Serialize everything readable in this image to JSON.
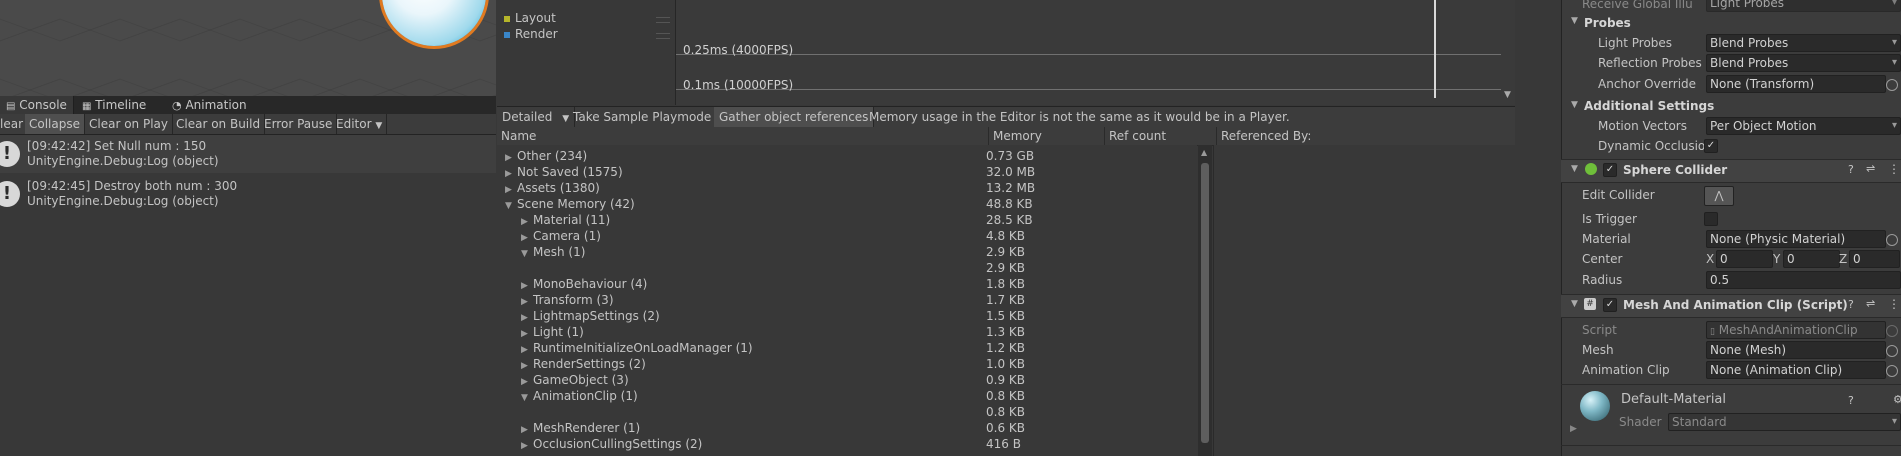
{
  "scene": {},
  "console": {
    "tabs": [
      {
        "label": "Console",
        "icon": "console-icon"
      },
      {
        "label": "Timeline",
        "icon": "timeline-icon"
      },
      {
        "label": "Animation",
        "icon": "animation-icon"
      }
    ],
    "toolbar": {
      "clear": "lear",
      "collapse": "Collapse",
      "clear_on_play": "Clear on Play",
      "clear_on_build": "Clear on Build",
      "error_pause": "Error Pause",
      "editor": "Editor"
    },
    "logs": [
      {
        "line1": "[09:42:42] Set Null num :  150",
        "line2": "UnityEngine.Debug:Log (object)"
      },
      {
        "line1": "[09:42:45] Destroy both num :  300",
        "line2": "UnityEngine.Debug:Log (object)"
      }
    ]
  },
  "profiler": {
    "legend": [
      {
        "label": "Layout",
        "color": "#b5b52a"
      },
      {
        "label": "Render",
        "color": "#3a86c8"
      }
    ],
    "gridlines": [
      "0.25ms (4000FPS)",
      "0.1ms (10000FPS)"
    ],
    "toolbar": {
      "view_mode": "Detailed",
      "take_sample": "Take Sample Playmode",
      "gather_refs": "Gather object references",
      "notice": "Memory usage in the Editor is not the same as it would be in a Player."
    },
    "columns": {
      "name": "Name",
      "memory": "Memory",
      "ref_count": "Ref count",
      "referenced_by": "Referenced By:"
    },
    "rows": [
      {
        "name": "Other (234)",
        "memory": "0.73 GB",
        "expanded": false,
        "level": 0
      },
      {
        "name": "Not Saved (1575)",
        "memory": "32.0 MB",
        "expanded": false,
        "level": 0
      },
      {
        "name": "Assets (1380)",
        "memory": "13.2 MB",
        "expanded": false,
        "level": 0
      },
      {
        "name": "Scene Memory (42)",
        "memory": "48.8 KB",
        "expanded": true,
        "level": 0
      },
      {
        "name": "Material (11)",
        "memory": "28.5 KB",
        "expanded": false,
        "level": 1
      },
      {
        "name": "Camera (1)",
        "memory": "4.8 KB",
        "expanded": false,
        "level": 1
      },
      {
        "name": "Mesh (1)",
        "memory": "2.9 KB",
        "expanded": true,
        "level": 1
      },
      {
        "name": "",
        "memory": "2.9 KB",
        "expanded": null,
        "level": 2
      },
      {
        "name": "MonoBehaviour (4)",
        "memory": "1.8 KB",
        "expanded": false,
        "level": 1
      },
      {
        "name": "Transform (3)",
        "memory": "1.7 KB",
        "expanded": false,
        "level": 1
      },
      {
        "name": "LightmapSettings (2)",
        "memory": "1.5 KB",
        "expanded": false,
        "level": 1
      },
      {
        "name": "Light (1)",
        "memory": "1.3 KB",
        "expanded": false,
        "level": 1
      },
      {
        "name": "RuntimeInitializeOnLoadManager (1)",
        "memory": "1.2 KB",
        "expanded": false,
        "level": 1
      },
      {
        "name": "RenderSettings (2)",
        "memory": "1.0 KB",
        "expanded": false,
        "level": 1
      },
      {
        "name": "GameObject (3)",
        "memory": "0.9 KB",
        "expanded": false,
        "level": 1
      },
      {
        "name": "AnimationClip (1)",
        "memory": "0.8 KB",
        "expanded": true,
        "level": 1
      },
      {
        "name": "",
        "memory": "0.8 KB",
        "expanded": null,
        "level": 2
      },
      {
        "name": "MeshRenderer (1)",
        "memory": "0.6 KB",
        "expanded": false,
        "level": 1
      },
      {
        "name": "OcclusionCullingSettings (2)",
        "memory": "416 B",
        "expanded": false,
        "level": 1
      }
    ]
  },
  "inspector": {
    "receive_gi_label": "Receive Global Illu",
    "receive_gi_value": "Light Probes",
    "probes": {
      "header": "Probes",
      "light_probes_label": "Light Probes",
      "light_probes_value": "Blend Probes",
      "reflection_probes_label": "Reflection Probes",
      "reflection_probes_value": "Blend Probes",
      "anchor_override_label": "Anchor Override",
      "anchor_override_value": "None (Transform)"
    },
    "additional": {
      "header": "Additional Settings",
      "motion_vectors_label": "Motion Vectors",
      "motion_vectors_value": "Per Object Motion",
      "dynamic_occlusion_label": "Dynamic Occlusio"
    },
    "sphere_collider": {
      "title": "Sphere Collider",
      "edit_collider": "Edit Collider",
      "is_trigger": "Is Trigger",
      "material_label": "Material",
      "material_value": "None (Physic Material)",
      "center_label": "Center",
      "center_x_label": "X",
      "center_x": "0",
      "center_y_label": "Y",
      "center_y": "0",
      "center_z_label": "Z",
      "center_z": "0",
      "radius_label": "Radius",
      "radius_value": "0.5"
    },
    "script_component": {
      "title": "Mesh And Animation Clip (Script)",
      "script_label": "Script",
      "script_value": "MeshAndAnimationClip",
      "mesh_label": "Mesh",
      "mesh_value": "None (Mesh)",
      "anim_label": "Animation Clip",
      "anim_value": "None (Animation Clip)"
    },
    "material": {
      "name": "Default-Material",
      "shader_label": "Shader",
      "shader_value": "Standard"
    }
  }
}
